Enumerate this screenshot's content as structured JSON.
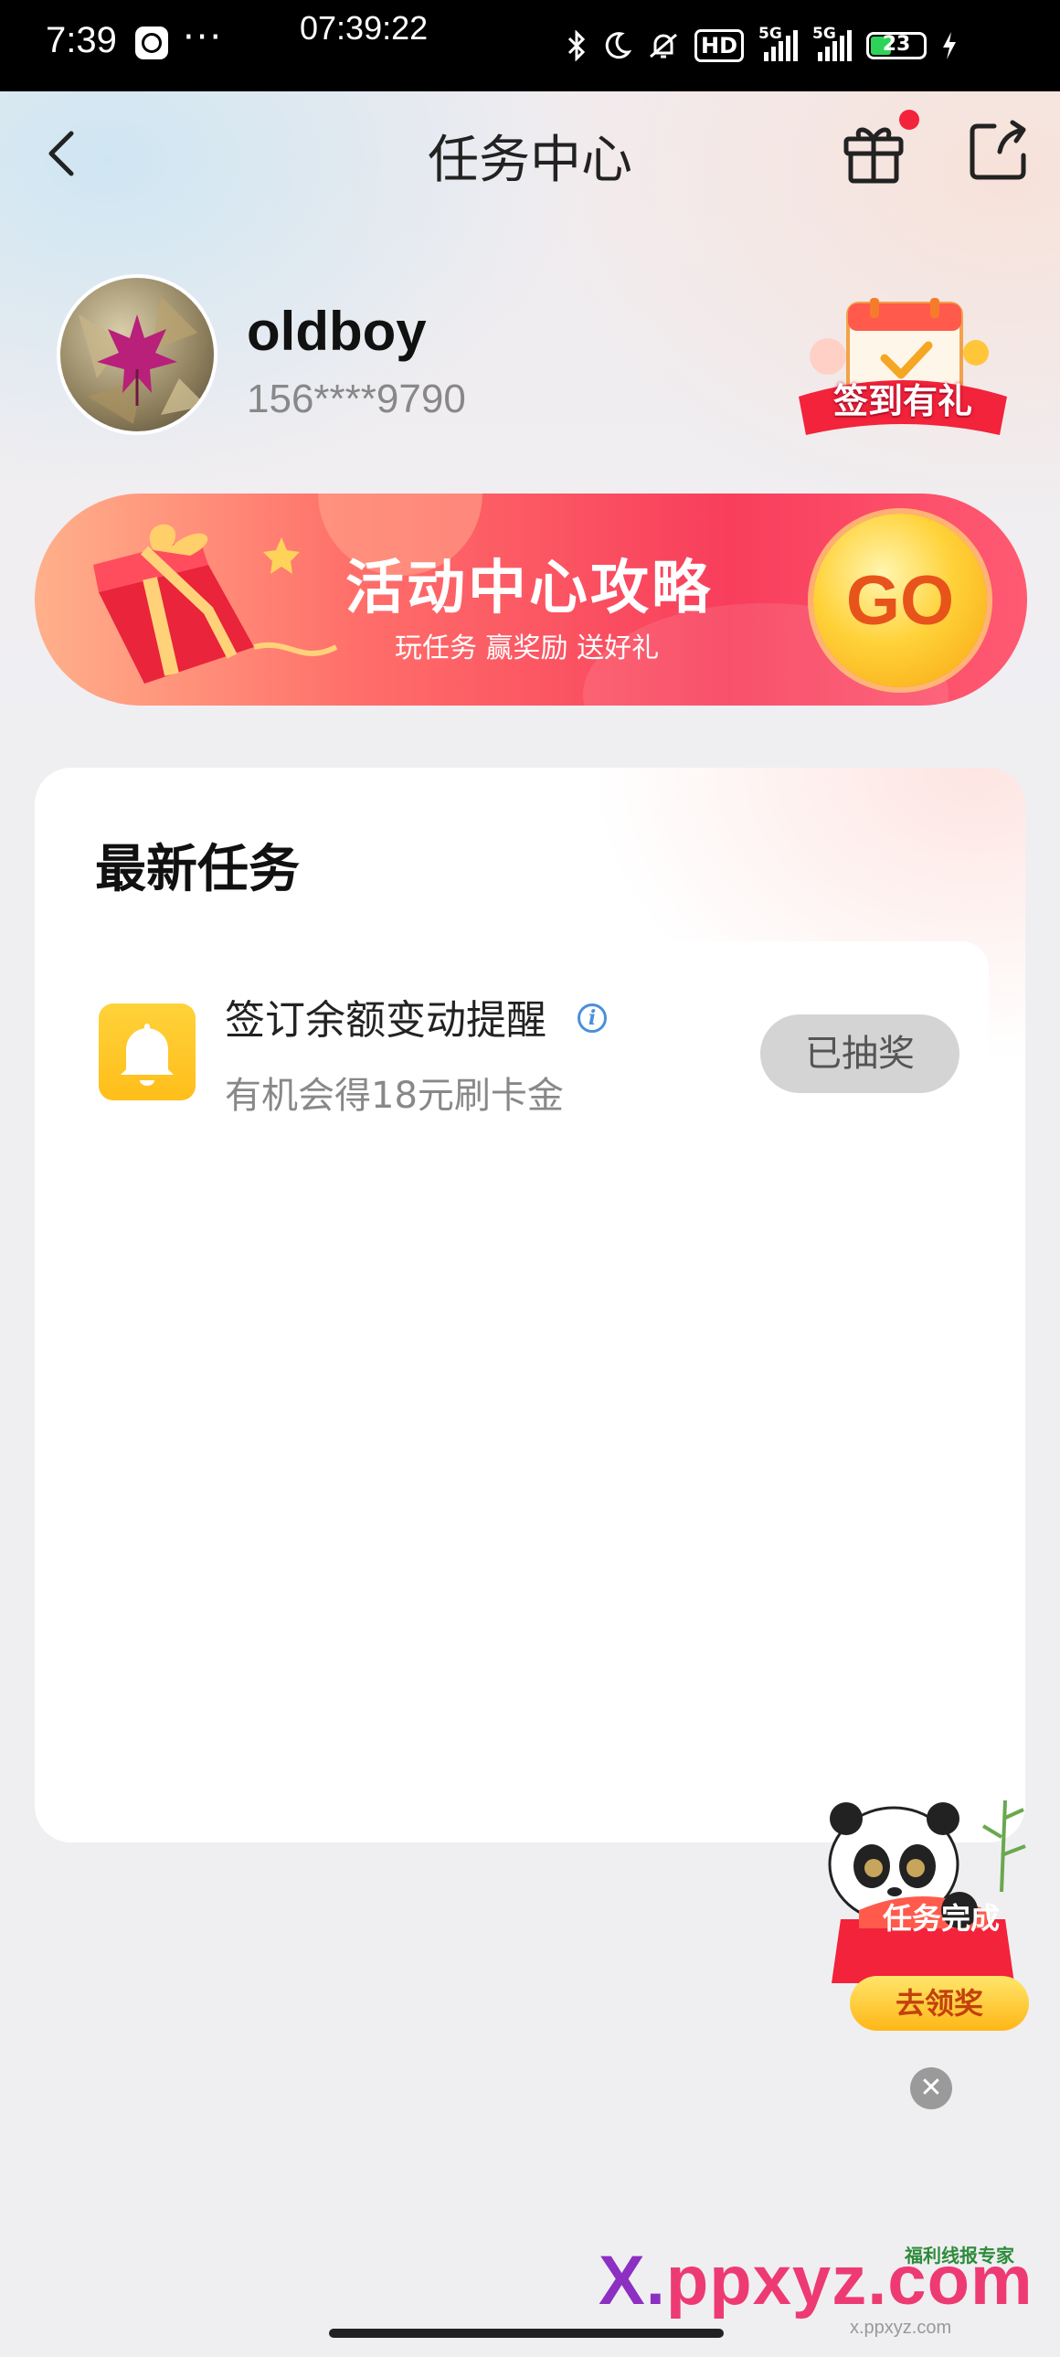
{
  "status_bar": {
    "time": "7:39",
    "more": "···",
    "center_time": "07:39:22",
    "hd": "HD",
    "network_1": "5G",
    "network_2": "5G",
    "battery": "23"
  },
  "header": {
    "title": "任务中心"
  },
  "profile": {
    "username": "oldboy",
    "phone": "156****9790",
    "signin_label": "签到有礼"
  },
  "banner": {
    "title": "活动中心攻略",
    "subtitle": "玩任务 赢奖励 送好礼",
    "go_label": "GO"
  },
  "tasks": {
    "section_title": "最新任务",
    "items": [
      {
        "name": "签订余额变动提醒",
        "description": "有机会得18元刷卡金",
        "button_label": "已抽奖",
        "icon": "bell-icon"
      }
    ]
  },
  "floating_widget": {
    "task_text": "任务完成",
    "reward_label": "去领奖",
    "close_label": "✕"
  },
  "watermark": {
    "text_x": "X.",
    "text_rest": "ppxyz.com",
    "badge": "福利线报专家",
    "url": "x.ppxyz.com"
  },
  "colors": {
    "accent_red": "#f83e5c",
    "go_yellow": "#ffd23a",
    "task_icon_yellow": "#ffc21f",
    "button_disabled": "#d4d4d4"
  }
}
